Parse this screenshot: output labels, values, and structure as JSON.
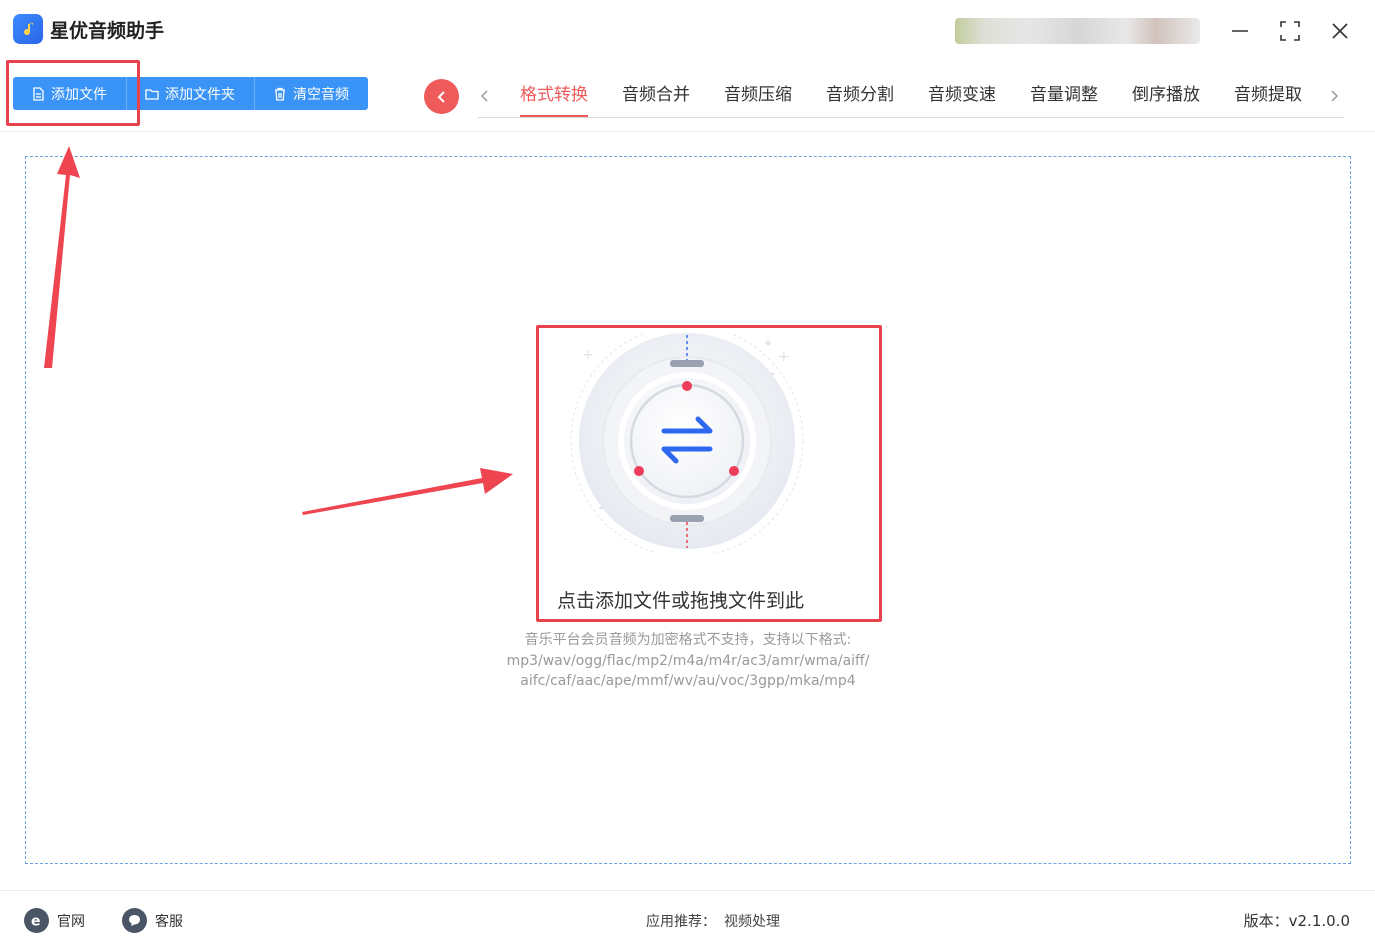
{
  "app": {
    "title": "星优音频助手"
  },
  "toolbar": {
    "add_file": "添加文件",
    "add_folder": "添加文件夹",
    "clear_audio": "清空音频"
  },
  "tabs": [
    {
      "label": "格式转换",
      "active": true
    },
    {
      "label": "音频合并"
    },
    {
      "label": "音频压缩"
    },
    {
      "label": "音频分割"
    },
    {
      "label": "音频变速"
    },
    {
      "label": "音量调整"
    },
    {
      "label": "倒序播放"
    },
    {
      "label": "音频提取"
    }
  ],
  "dropzone": {
    "prompt": "点击添加文件或拖拽文件到此",
    "hint_line1": "音乐平台会员音频为加密格式不支持，支持以下格式:",
    "hint_line2": "mp3/wav/ogg/flac/mp2/m4a/m4r/ac3/amr/wma/aiff/",
    "hint_line3": "aifc/caf/aac/ape/mmf/wv/au/voc/3gpp/mka/mp4"
  },
  "footer": {
    "website": "官网",
    "support": "客服",
    "recommend_label": "应用推荐：",
    "recommend_link": "视频处理",
    "version": "版本：v2.1.0.0"
  },
  "colors": {
    "accent_blue": "#3a93f6",
    "accent_red": "#ee5a5a",
    "highlight": "#e8434d"
  },
  "icons": [
    "app-icon",
    "file-icon",
    "folder-icon",
    "trash-icon",
    "chevron-left-icon",
    "chevron-right-icon",
    "swap-arrows-icon",
    "ie-icon",
    "chat-icon",
    "minimize-icon",
    "maximize-icon",
    "close-icon"
  ]
}
